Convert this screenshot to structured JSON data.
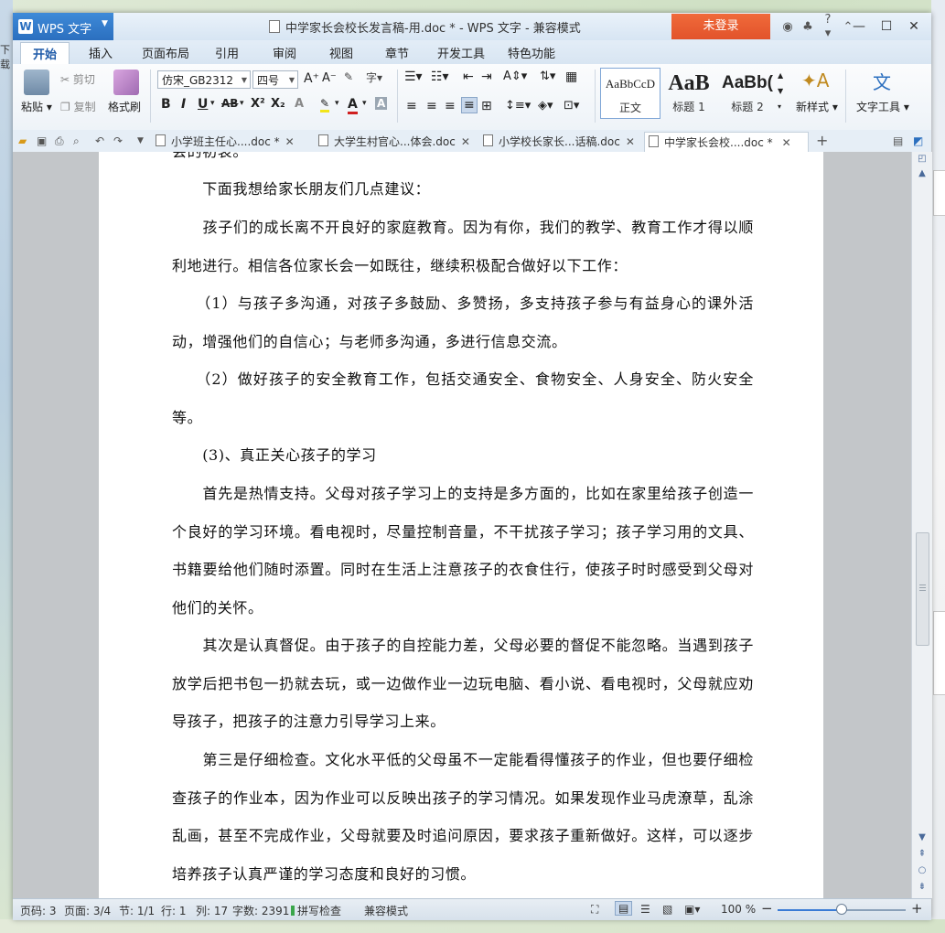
{
  "background": {
    "edge_text": "下载"
  },
  "titlebar": {
    "app_name": "WPS 文字",
    "app_logo": "W",
    "document_title": "中学家长会校长发言稿-用.doc * - WPS 文字 - 兼容模式",
    "login_label": "未登录",
    "icons": [
      "skin-icon",
      "shirt-icon",
      "help-icon",
      "collapse-icon"
    ],
    "help_label": "?"
  },
  "menu": {
    "tabs": [
      "开始",
      "插入",
      "页面布局",
      "引用",
      "审阅",
      "视图",
      "章节",
      "开发工具",
      "特色功能"
    ]
  },
  "ribbon": {
    "paste_label": "粘贴",
    "cut_label": "剪切",
    "copy_label": "复制",
    "format_painter_label": "格式刷",
    "font_name": "仿宋_GB2312",
    "font_size": "四号",
    "styles": [
      {
        "sample": "AaBbCcD",
        "label": "正文"
      },
      {
        "sample": "AaB",
        "label": "标题 1"
      },
      {
        "sample": "AaBb(",
        "label": "标题 2"
      }
    ],
    "new_style_label": "新样式",
    "text_tools_label": "文字工具",
    "accent_color": "#2b6fbf"
  },
  "doc_tabs": [
    {
      "label": "小学班主任心....doc *",
      "active": false
    },
    {
      "label": "大学生村官心...体会.doc",
      "active": false
    },
    {
      "label": "小学校长家长...话稿.doc",
      "active": false
    },
    {
      "label": "中学家长会校....doc *",
      "active": true
    }
  ],
  "document": {
    "paragraphs": [
      "会的初衷。",
      "　　下面我想给家长朋友们几点建议：",
      "　　孩子们的成长离不开良好的家庭教育。因为有你，我们的教学、教育工作才得以顺利地进行。相信各位家长会一如既往，继续积极配合做好以下工作：",
      "　　（1）与孩子多沟通，对孩子多鼓励、多赞扬，多支持孩子参与有益身心的课外活动，增强他们的自信心；与老师多沟通，多进行信息交流。",
      "　　（2）做好孩子的安全教育工作，包括交通安全、食物安全、人身安全、防火安全等。",
      "　　(3)、真正关心孩子的学习",
      "　　首先是热情支持。父母对孩子学习上的支持是多方面的，比如在家里给孩子创造一个良好的学习环境。看电视时，尽量控制音量，不干扰孩子学习；孩子学习用的文具、书籍要给他们随时添置。同时在生活上注意孩子的衣食住行，使孩子时时感受到父母对他们的关怀。",
      "　　其次是认真督促。由于孩子的自控能力差，父母必要的督促不能忽略。当遇到孩子放学后把书包一扔就去玩，或一边做作业一边玩电脑、看小说、看电视时，父母就应劝导孩子，把孩子的注意力引导学习上来。",
      "　　第三是仔细检查。文化水平低的父母虽不一定能看得懂孩子的作业，但也要仔细检查孩子的作业本，因为作业可以反映出孩子的学习情况。如果发现作业马虎潦草，乱涂乱画，甚至不完成作业，父母就要及时追问原因，要求孩子重新做好。这样，可以逐步培养孩子认真严谨的学习态度和良好的习惯。"
    ]
  },
  "statusbar": {
    "page_num": "页码: 3",
    "pages": "页面: 3/4",
    "section": "节: 1/1",
    "row": "行: 1",
    "col": "列: 17",
    "word_count": "字数: 2391",
    "spell_check": "拼写检查",
    "compat_mode": "兼容模式",
    "zoom": "100 %",
    "zoom_level": 0.5
  }
}
